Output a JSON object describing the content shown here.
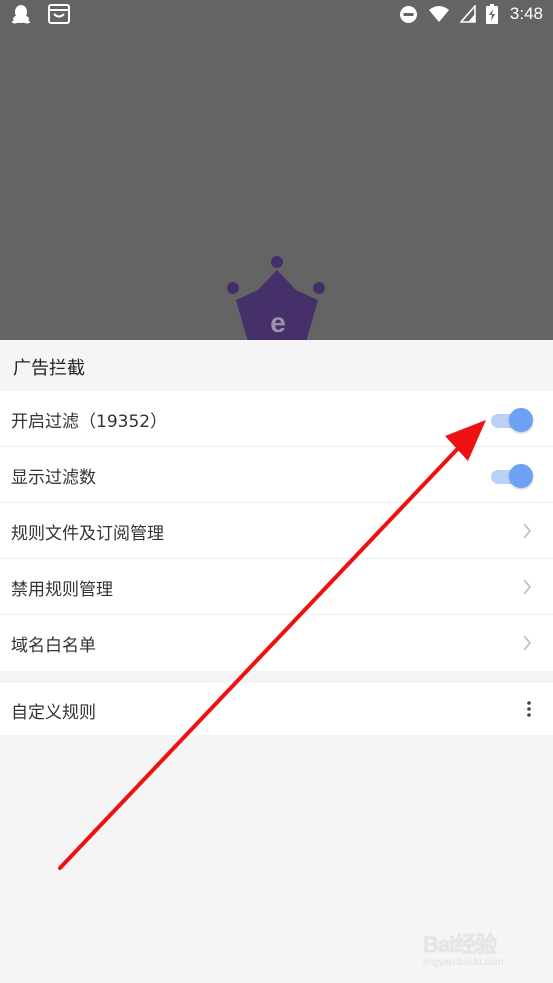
{
  "status_bar": {
    "time": "3:48",
    "left_icons": [
      "qq-icon",
      "message-box-icon"
    ],
    "right_icons": [
      "do-not-disturb-icon",
      "wifi-icon",
      "cellular-signal-icon",
      "battery-charging-icon"
    ]
  },
  "app": {
    "logo": "crown-e-logo"
  },
  "panel": {
    "title": "广告拦截",
    "items": [
      {
        "label": "开启过滤（19352）",
        "control": "toggle",
        "checked": true
      },
      {
        "label": "显示过滤数",
        "control": "toggle",
        "checked": true
      },
      {
        "label": "规则文件及订阅管理",
        "control": "chevron"
      },
      {
        "label": "禁用规则管理",
        "control": "chevron"
      },
      {
        "label": "域名白名单",
        "control": "chevron"
      }
    ],
    "custom_rules": {
      "label": "自定义规则",
      "control": "more"
    }
  },
  "watermark": {
    "brand": "Bai经验",
    "url": "jingyan.baidu.com"
  },
  "colors": {
    "top_background": "#646464",
    "panel_background": "#f5f5f5",
    "toggle_thumb": "#6ea0f5",
    "toggle_track": "#b9d0f7",
    "arrow": "#ee1111",
    "logo": "#46306a"
  }
}
